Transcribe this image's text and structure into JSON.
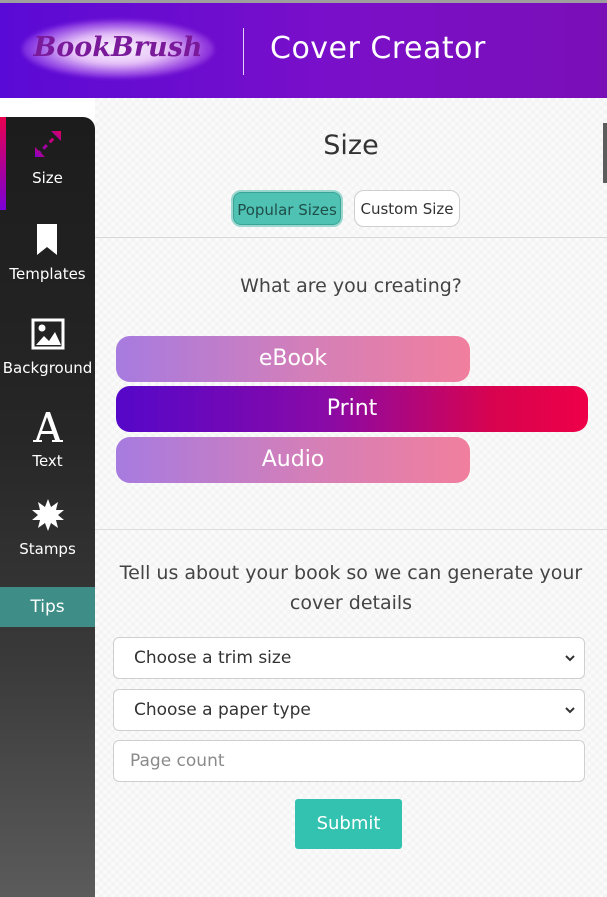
{
  "header": {
    "logo_text": "BookBrush",
    "title": "Cover Creator"
  },
  "sidebar": {
    "items": [
      {
        "label": "Size",
        "icon": "resize-arrows-icon"
      },
      {
        "label": "Templates",
        "icon": "bookmark-icon"
      },
      {
        "label": "Background",
        "icon": "image-icon"
      },
      {
        "label": "Text",
        "icon": "letter-a-icon"
      },
      {
        "label": "Stamps",
        "icon": "starburst-icon"
      }
    ],
    "active_index": 0,
    "tips_label": "Tips"
  },
  "main": {
    "title": "Size",
    "segments": {
      "popular": "Popular Sizes",
      "custom": "Custom Size",
      "active": "popular"
    },
    "question": "What are you creating?",
    "choices": [
      {
        "label": "eBook",
        "selected": false
      },
      {
        "label": "Print",
        "selected": true
      },
      {
        "label": "Audio",
        "selected": false
      }
    ],
    "details_prompt": "Tell us about your book so we can generate your cover details",
    "trim_select": "Choose a trim size",
    "paper_select": "Choose a paper type",
    "page_count_placeholder": "Page count",
    "submit_label": "Submit"
  },
  "colors": {
    "header_start": "#5a0ad6",
    "header_end": "#7a0fb8",
    "teal": "#33c2b0",
    "tips_bg": "#3e8d87",
    "print_start": "#5507c9",
    "print_end": "#ee0048"
  }
}
